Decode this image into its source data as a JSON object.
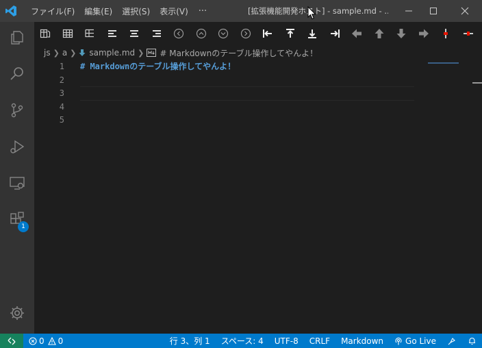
{
  "menu": [
    "ファイル(F)",
    "編集(E)",
    "選択(S)",
    "表示(V)"
  ],
  "menu_more": "···",
  "window_title": "[拡張機能開発ホスト] - sample.md - ...",
  "breadcrumb": {
    "folder1": "js",
    "folder2": "a",
    "file": "sample.md",
    "symbol": "# Markdownのテーブル操作してやんよ！"
  },
  "editor": {
    "line_numbers": [
      "1",
      "2",
      "3",
      "4",
      "5"
    ],
    "lines": [
      "# Markdownのテーブル操作してやんよ！",
      "",
      "",
      "",
      ""
    ]
  },
  "activity": {
    "extensions_badge": "1"
  },
  "status": {
    "errors": "0",
    "warnings": "0",
    "position": "行 3、列 1",
    "spaces": "スペース: 4",
    "encoding": "UTF-8",
    "eol": "CRLF",
    "language": "Markdown",
    "golive": "Go Live"
  },
  "colors": {
    "titlebar": "#3c3c3c",
    "activitybar": "#333333",
    "editor_bg": "#1e1e1e",
    "statusbar": "#007acc",
    "remote": "#16825d",
    "heading": "#569cd6"
  },
  "icons": {
    "activity": [
      "explorer-icon",
      "search-icon",
      "source-control-icon",
      "run-debug-icon",
      "remote-explorer-icon",
      "extensions-icon",
      "settings-gear-icon"
    ],
    "toolbar": [
      "table-format-icon",
      "table-insert-icon",
      "table-tree-icon",
      "align-left-icon",
      "align-center-icon",
      "align-right-icon",
      "prev-cell-icon",
      "up-cell-icon",
      "down-cell-icon",
      "next-cell-icon",
      "insert-column-left-icon",
      "insert-row-above-icon",
      "insert-row-below-icon",
      "insert-column-right-icon",
      "move-left-icon",
      "move-up-icon",
      "move-down-icon",
      "move-right-icon",
      "delete-column-icon",
      "delete-row-icon"
    ]
  }
}
